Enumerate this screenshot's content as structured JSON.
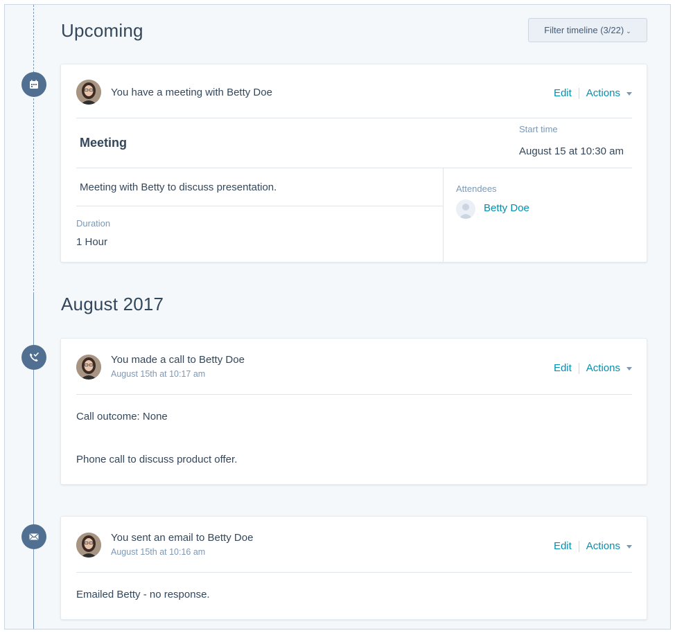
{
  "header": {
    "upcoming_title": "Upcoming",
    "filter_label": "Filter timeline (3/22)",
    "filter_chevron": "⌄"
  },
  "meeting_card": {
    "icon": "meeting-calendar-icon",
    "title_prefix": "You have a meeting with",
    "contact": "Betty Doe",
    "edit_label": "Edit",
    "actions_label": "Actions",
    "meeting_title": "Meeting",
    "start_time_label": "Start time",
    "start_time_value": "August 15 at 10:30 am",
    "description": "Meeting with Betty to discuss presentation.",
    "duration_label": "Duration",
    "duration_value": "1 Hour",
    "attendees_label": "Attendees",
    "attendee_name": "Betty Doe"
  },
  "month_title": "August 2017",
  "call_card": {
    "icon": "phone-call-icon",
    "title_prefix": "You made a call to",
    "contact": "Betty Doe",
    "timestamp": "August 15th at 10:17 am",
    "edit_label": "Edit",
    "actions_label": "Actions",
    "outcome_label": "Call outcome:",
    "outcome_value": "None",
    "notes": "Phone call to discuss product offer."
  },
  "email_card": {
    "icon": "email-envelope-icon",
    "title_prefix": "You sent an email to",
    "contact": "Betty Doe",
    "timestamp": "August 15th at 10:16 am",
    "edit_label": "Edit",
    "actions_label": "Actions",
    "notes": "Emailed Betty - no response."
  },
  "colors": {
    "accent_link": "#0091ae",
    "marker_bg": "#516f90",
    "text_primary": "#33475b",
    "text_secondary": "#7c98b6",
    "page_bg": "#f5f8fa"
  }
}
